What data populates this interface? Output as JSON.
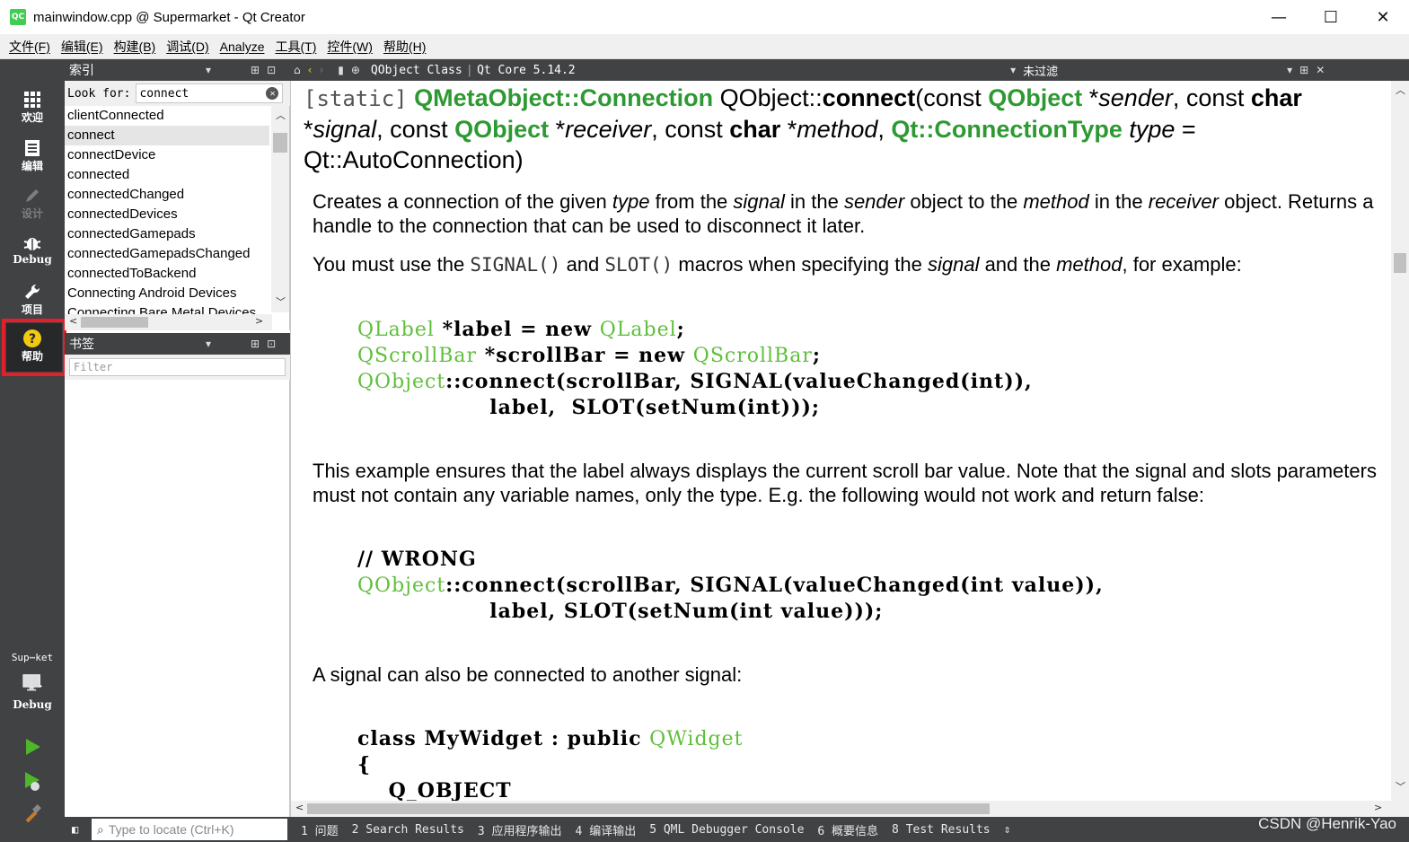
{
  "window": {
    "title": "mainwindow.cpp @ Supermarket - Qt Creator",
    "app_icon": "QC",
    "minimize": "—",
    "maximize": "☐",
    "close": "✕"
  },
  "menu": [
    "文件(F)",
    "编辑(E)",
    "构建(B)",
    "调试(D)",
    "Analyze",
    "工具(T)",
    "控件(W)",
    "帮助(H)"
  ],
  "modes": {
    "welcome": "欢迎",
    "edit": "编辑",
    "design": "设计",
    "debug": "Debug",
    "projects": "项目",
    "help": "帮助"
  },
  "target": {
    "project": "Sup⋯ket",
    "config": "Debug"
  },
  "index_panel": {
    "title": "索引",
    "look_for_label": "Look for:",
    "look_for_value": "connect",
    "items": [
      "clientConnected",
      "connect",
      "connectDevice",
      "connected",
      "connectedChanged",
      "connectedDevices",
      "connectedGamepads",
      "connectedGamepadsChanged",
      "connectedToBackend",
      "Connecting Android Devices",
      "Connecting Bare Metal Devices"
    ],
    "selected_index": 1
  },
  "bookmark_panel": {
    "title": "书签",
    "filter_placeholder": "Filter"
  },
  "doc_toolbar": {
    "breadcrumb_class": "QObject Class",
    "breadcrumb_module": "Qt Core 5.14.2",
    "filter": "未过滤"
  },
  "doc": {
    "sig_static": "[static]",
    "sig_ret": "QMetaObject::Connection",
    "sig_scope": " QObject::",
    "sig_name": "connect",
    "para1": "Creates a connection of the given type from the signal in the sender object to the method in the receiver object. Returns a handle to the connection that can be used to disconnect it later.",
    "para2_a": "You must use the ",
    "para2_sig": "SIGNAL()",
    "para2_b": " and ",
    "para2_slot": "SLOT()",
    "para2_c": " macros when specifying the ",
    "para2_signal": "signal",
    "para2_d": " and the ",
    "para2_method": "method",
    "para2_e": ", for example:",
    "para3": "This example ensures that the label always displays the current scroll bar value. Note that the signal and slots parameters must not contain any variable names, only the type. E.g. the following would not work and return false:",
    "para4": "A signal can also be connected to another signal:"
  },
  "statusbar": {
    "locator_placeholder": "Type to locate (Ctrl+K)",
    "tabs": [
      "1 问题",
      "2 Search Results",
      "3 应用程序输出",
      "4 编译输出",
      "5 QML Debugger Console",
      "6 概要信息",
      "8 Test Results"
    ]
  },
  "watermark": "CSDN @Henrik-Yao",
  "colors": {
    "accent_green": "#2e9933",
    "code_green": "#5fbf3b",
    "panel_dark": "#404244",
    "highlight_red": "#e3202a",
    "help_yellow": "#f2c811"
  }
}
